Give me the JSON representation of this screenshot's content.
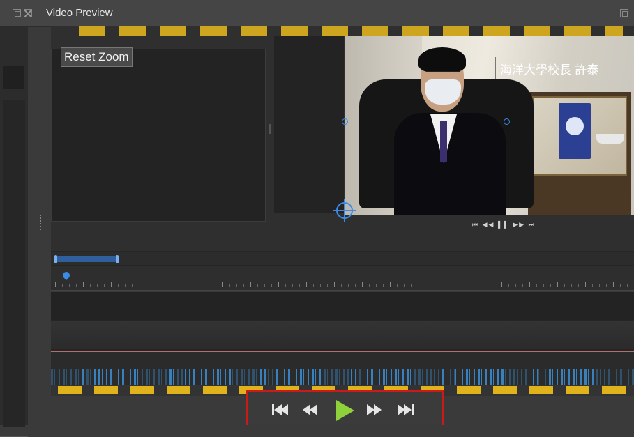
{
  "window": {
    "title": "Video Preview"
  },
  "preview": {
    "reset_zoom_label": "Reset Zoom",
    "clip_caption": "海洋大學校長 許泰"
  },
  "timeline": {
    "track2_clip_label": "",
    "track3_clip_label": ""
  },
  "transport": {
    "buttons": [
      "jump-to-start",
      "rewind",
      "play",
      "fast-forward",
      "jump-to-end"
    ],
    "play_color": "#8fd13a",
    "highlight_color": "#cc1a1a"
  },
  "colors": {
    "accent": "#3b8be6",
    "playhead": "#c13b3b",
    "background": "#3a3a3a"
  }
}
